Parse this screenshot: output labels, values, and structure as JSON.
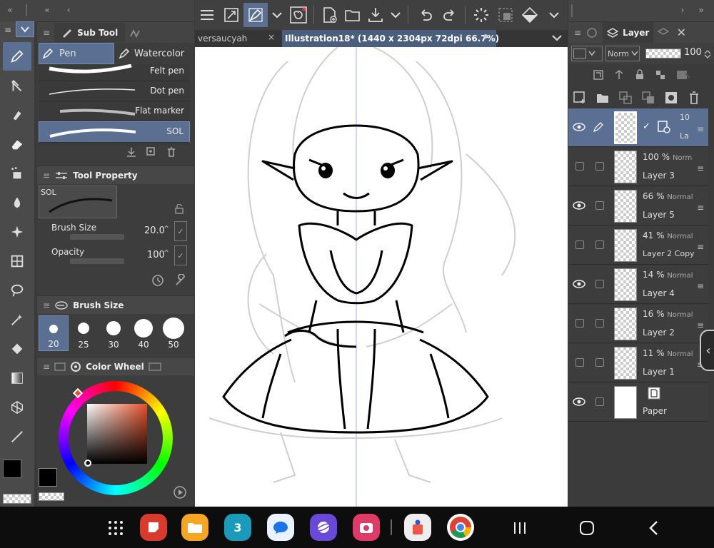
{
  "left_panel": {
    "subtool_tab": "Sub Tool",
    "tab_pen": "Pen",
    "tab_watercolor": "Watercolor",
    "brushes": [
      "Felt pen",
      "Dot pen",
      "Flat marker",
      "SOL"
    ],
    "tool_property_title": "Tool Property",
    "preview_label": "SOL",
    "brush_size_label": "Brush Size",
    "brush_size_value": "20.0",
    "opacity_label": "Opacity",
    "opacity_value": "100",
    "brush_size_panel_title": "Brush Size",
    "brush_sizes": [
      "20",
      "25",
      "30",
      "40",
      "50"
    ],
    "color_wheel_title": "Color Wheel",
    "rgb_values": [
      "0",
      "0",
      "0"
    ]
  },
  "document": {
    "tab_inactive": "versaucyah",
    "tab_active": "Illustration18* (1440 x 2304px 72dpi 66.7%)"
  },
  "layer_panel": {
    "title": "Layer",
    "blend_mode": "Norm",
    "opacity": "100",
    "layers": [
      {
        "pct": "10",
        "name": "La",
        "visible": true,
        "selected": true
      },
      {
        "pct": "100 %",
        "mode": "Norm",
        "name": "Layer 3",
        "visible": false
      },
      {
        "pct": "66 %",
        "mode": "Normal",
        "name": "Layer 5",
        "visible": true
      },
      {
        "pct": "41 %",
        "mode": "Normal",
        "name": "Layer 2 Copy",
        "visible": false
      },
      {
        "pct": "14 %",
        "mode": "Normal",
        "name": "Layer 4",
        "visible": true
      },
      {
        "pct": "16 %",
        "mode": "Normal",
        "name": "Layer 2",
        "visible": false
      },
      {
        "pct": "11 %",
        "mode": "Normal",
        "name": "Layer 1",
        "visible": false
      },
      {
        "pct": "",
        "mode": "",
        "name": "Paper",
        "visible": true
      }
    ]
  },
  "calendar_badge": "3",
  "colors": {
    "accent": "#5a6f91",
    "panel": "#3d3d3d"
  }
}
